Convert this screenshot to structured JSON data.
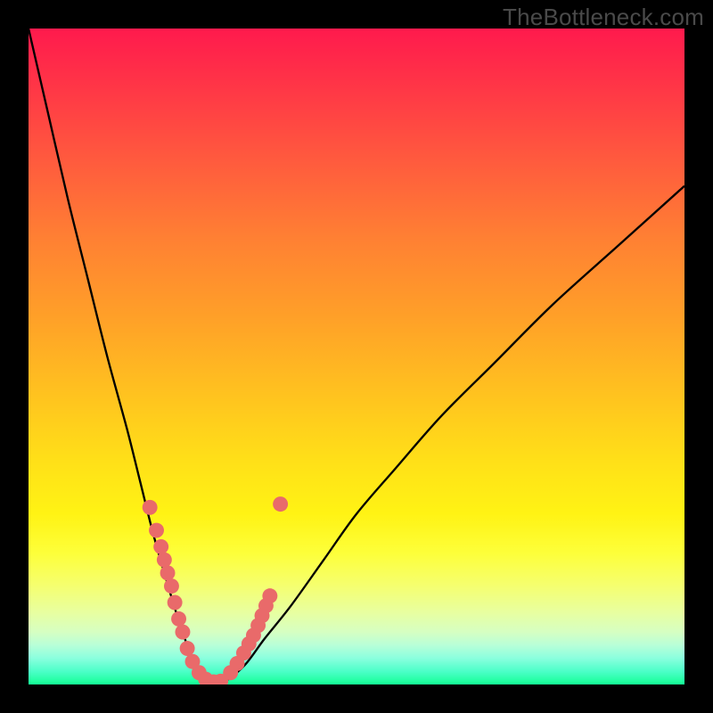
{
  "watermark": "TheBottleneck.com",
  "chart_data": {
    "type": "line",
    "title": "",
    "xlabel": "",
    "ylabel": "",
    "xlim": [
      0,
      100
    ],
    "ylim": [
      0,
      100
    ],
    "background_gradient": {
      "top_color": "#ff1a4d",
      "mid_color": "#ffe018",
      "bottom_color": "#13ff94"
    },
    "series": [
      {
        "name": "bottleneck-curve",
        "x": [
          0,
          3,
          6,
          9,
          12,
          15,
          17,
          19,
          21,
          22.5,
          24,
          25.5,
          27,
          28.5,
          30,
          33,
          36,
          40,
          45,
          50,
          56,
          63,
          71,
          80,
          90,
          100
        ],
        "y": [
          100,
          87,
          74,
          62,
          50,
          39,
          31,
          23,
          16,
          11,
          6.5,
          3,
          1,
          0,
          0.5,
          3,
          7,
          12,
          19,
          26,
          33,
          41,
          49,
          58,
          67,
          76
        ]
      }
    ],
    "scatter_points": {
      "name": "data-markers",
      "color": "#e96a6a",
      "x": [
        18.5,
        19.5,
        20.2,
        20.7,
        21.2,
        21.8,
        22.3,
        22.9,
        23.5,
        24.2,
        25.0,
        26.0,
        27.0,
        28.2,
        29.3,
        30.8,
        31.8,
        32.8,
        33.6,
        34.3,
        35.0,
        35.6,
        36.2,
        36.8,
        38.4
      ],
      "y": [
        27,
        23.5,
        21,
        19,
        17,
        15,
        12.5,
        10,
        8,
        5.5,
        3.5,
        1.8,
        0.8,
        0.4,
        0.5,
        1.8,
        3.2,
        4.8,
        6.2,
        7.5,
        9,
        10.5,
        12,
        13.5,
        27.5
      ]
    }
  }
}
